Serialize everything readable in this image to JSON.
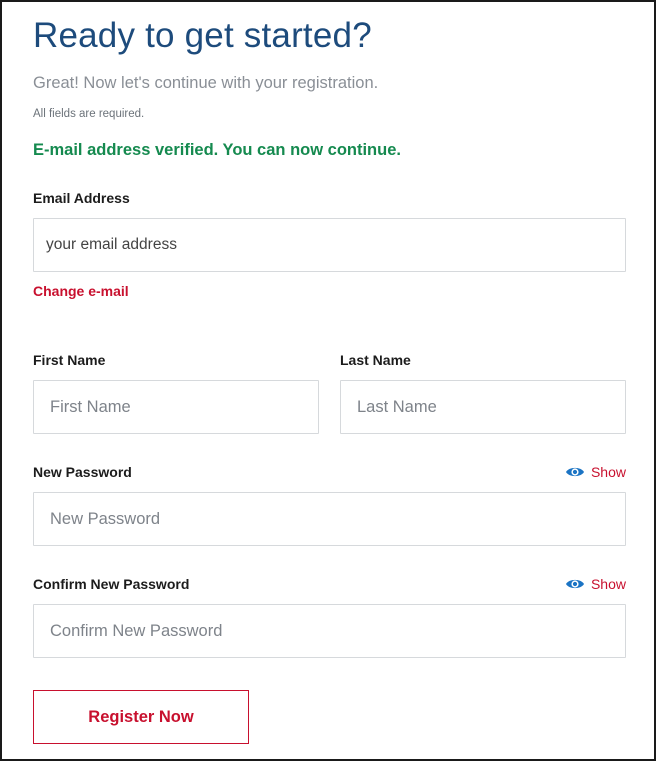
{
  "header": {
    "title": "Ready to get started?",
    "subtitle": "Great! Now let's continue with your registration.",
    "required_note": "All fields are required.",
    "verified_message": "E-mail address verified. You can now continue."
  },
  "email": {
    "label": "Email Address",
    "placeholder": "your email address",
    "change_link": "Change e-mail"
  },
  "first_name": {
    "label": "First Name",
    "placeholder": "First Name"
  },
  "last_name": {
    "label": "Last Name",
    "placeholder": "Last Name"
  },
  "new_password": {
    "label": "New Password",
    "placeholder": "New Password",
    "show_label": "Show"
  },
  "confirm_password": {
    "label": "Confirm New Password",
    "placeholder": "Confirm New Password",
    "show_label": "Show"
  },
  "actions": {
    "register_label": "Register Now"
  },
  "colors": {
    "title": "#1d4b7c",
    "verified": "#158a4f",
    "accent_red": "#c8102e",
    "eye_icon": "#1b74c4"
  },
  "icons": {
    "show_toggle": "eye-icon"
  }
}
